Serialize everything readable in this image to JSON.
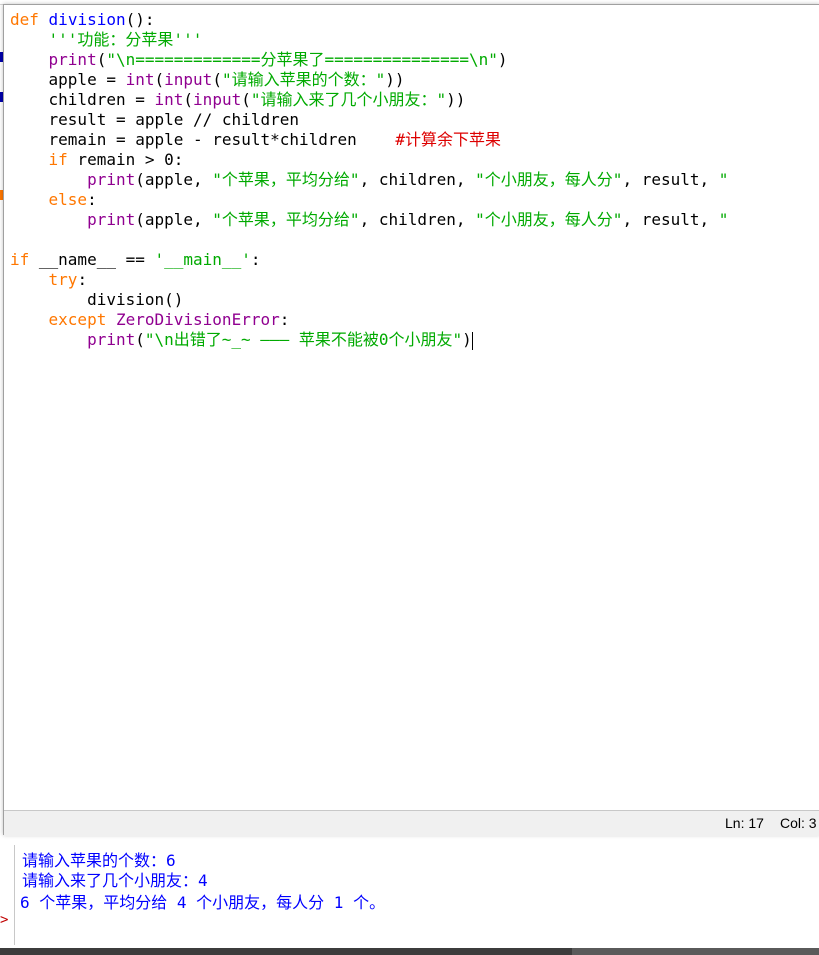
{
  "editor": {
    "code_lines": [
      [
        {
          "t": "def",
          "c": "kw"
        },
        {
          "t": " "
        },
        {
          "t": "division",
          "c": "df"
        },
        {
          "t": "():"
        }
      ],
      [
        {
          "t": "    "
        },
        {
          "t": "'''功能：分苹果'''",
          "c": "st"
        }
      ],
      [
        {
          "t": "    "
        },
        {
          "t": "print",
          "c": "bi"
        },
        {
          "t": "("
        },
        {
          "t": "\"\\n=============分苹果了===============\\n\"",
          "c": "st"
        },
        {
          "t": ")"
        }
      ],
      [
        {
          "t": "    apple = "
        },
        {
          "t": "int",
          "c": "bi"
        },
        {
          "t": "("
        },
        {
          "t": "input",
          "c": "bi"
        },
        {
          "t": "("
        },
        {
          "t": "\"请输入苹果的个数：\"",
          "c": "st"
        },
        {
          "t": "))"
        }
      ],
      [
        {
          "t": "    children = "
        },
        {
          "t": "int",
          "c": "bi"
        },
        {
          "t": "("
        },
        {
          "t": "input",
          "c": "bi"
        },
        {
          "t": "("
        },
        {
          "t": "\"请输入来了几个小朋友：\"",
          "c": "st"
        },
        {
          "t": "))"
        }
      ],
      [
        {
          "t": "    result = apple // children"
        }
      ],
      [
        {
          "t": "    remain = apple - result*children    "
        },
        {
          "t": "#计算余下苹果",
          "c": "cm"
        }
      ],
      [
        {
          "t": "    "
        },
        {
          "t": "if",
          "c": "kw"
        },
        {
          "t": " remain > 0:"
        }
      ],
      [
        {
          "t": "        "
        },
        {
          "t": "print",
          "c": "bi"
        },
        {
          "t": "(apple, "
        },
        {
          "t": "\"个苹果，平均分给\"",
          "c": "st"
        },
        {
          "t": ", children, "
        },
        {
          "t": "\"个小朋友，每人分\"",
          "c": "st"
        },
        {
          "t": ", result, "
        },
        {
          "t": "\"",
          "c": "st"
        }
      ],
      [
        {
          "t": "    "
        },
        {
          "t": "else",
          "c": "kw"
        },
        {
          "t": ":"
        }
      ],
      [
        {
          "t": "        "
        },
        {
          "t": "print",
          "c": "bi"
        },
        {
          "t": "(apple, "
        },
        {
          "t": "\"个苹果，平均分给\"",
          "c": "st"
        },
        {
          "t": ", children, "
        },
        {
          "t": "\"个小朋友，每人分\"",
          "c": "st"
        },
        {
          "t": ", result, "
        },
        {
          "t": "\"",
          "c": "st"
        }
      ],
      [],
      [
        {
          "t": "if",
          "c": "kw"
        },
        {
          "t": " __name__ == "
        },
        {
          "t": "'__main__'",
          "c": "st"
        },
        {
          "t": ":"
        }
      ],
      [
        {
          "t": "    "
        },
        {
          "t": "try",
          "c": "kw"
        },
        {
          "t": ":"
        }
      ],
      [
        {
          "t": "        division()"
        }
      ],
      [
        {
          "t": "    "
        },
        {
          "t": "except",
          "c": "kw"
        },
        {
          "t": " "
        },
        {
          "t": "ZeroDivisionError",
          "c": "bi"
        },
        {
          "t": ":"
        }
      ],
      [
        {
          "t": "        "
        },
        {
          "t": "print",
          "c": "bi"
        },
        {
          "t": "("
        },
        {
          "t": "\"\\n出错了~_~ ——— 苹果不能被0个小朋友\"",
          "c": "st"
        },
        {
          "t": ")"
        },
        {
          "t": "",
          "cursor": true
        }
      ]
    ]
  },
  "status": {
    "ln": "Ln: 17",
    "col": "Col: 3"
  },
  "shell": {
    "output_lines": [
      "请输入苹果的个数：6",
      "请输入来了几个小朋友：4",
      "6 个苹果，平均分给 4 个小朋友，每人分 1 个。"
    ],
    "prompt": ">"
  },
  "colors": {
    "keyword": "#ff7700",
    "builtin": "#900090",
    "string": "#00aa00",
    "comment": "#dd0000",
    "definition": "#0000ff",
    "shell_output": "#0000ff"
  }
}
